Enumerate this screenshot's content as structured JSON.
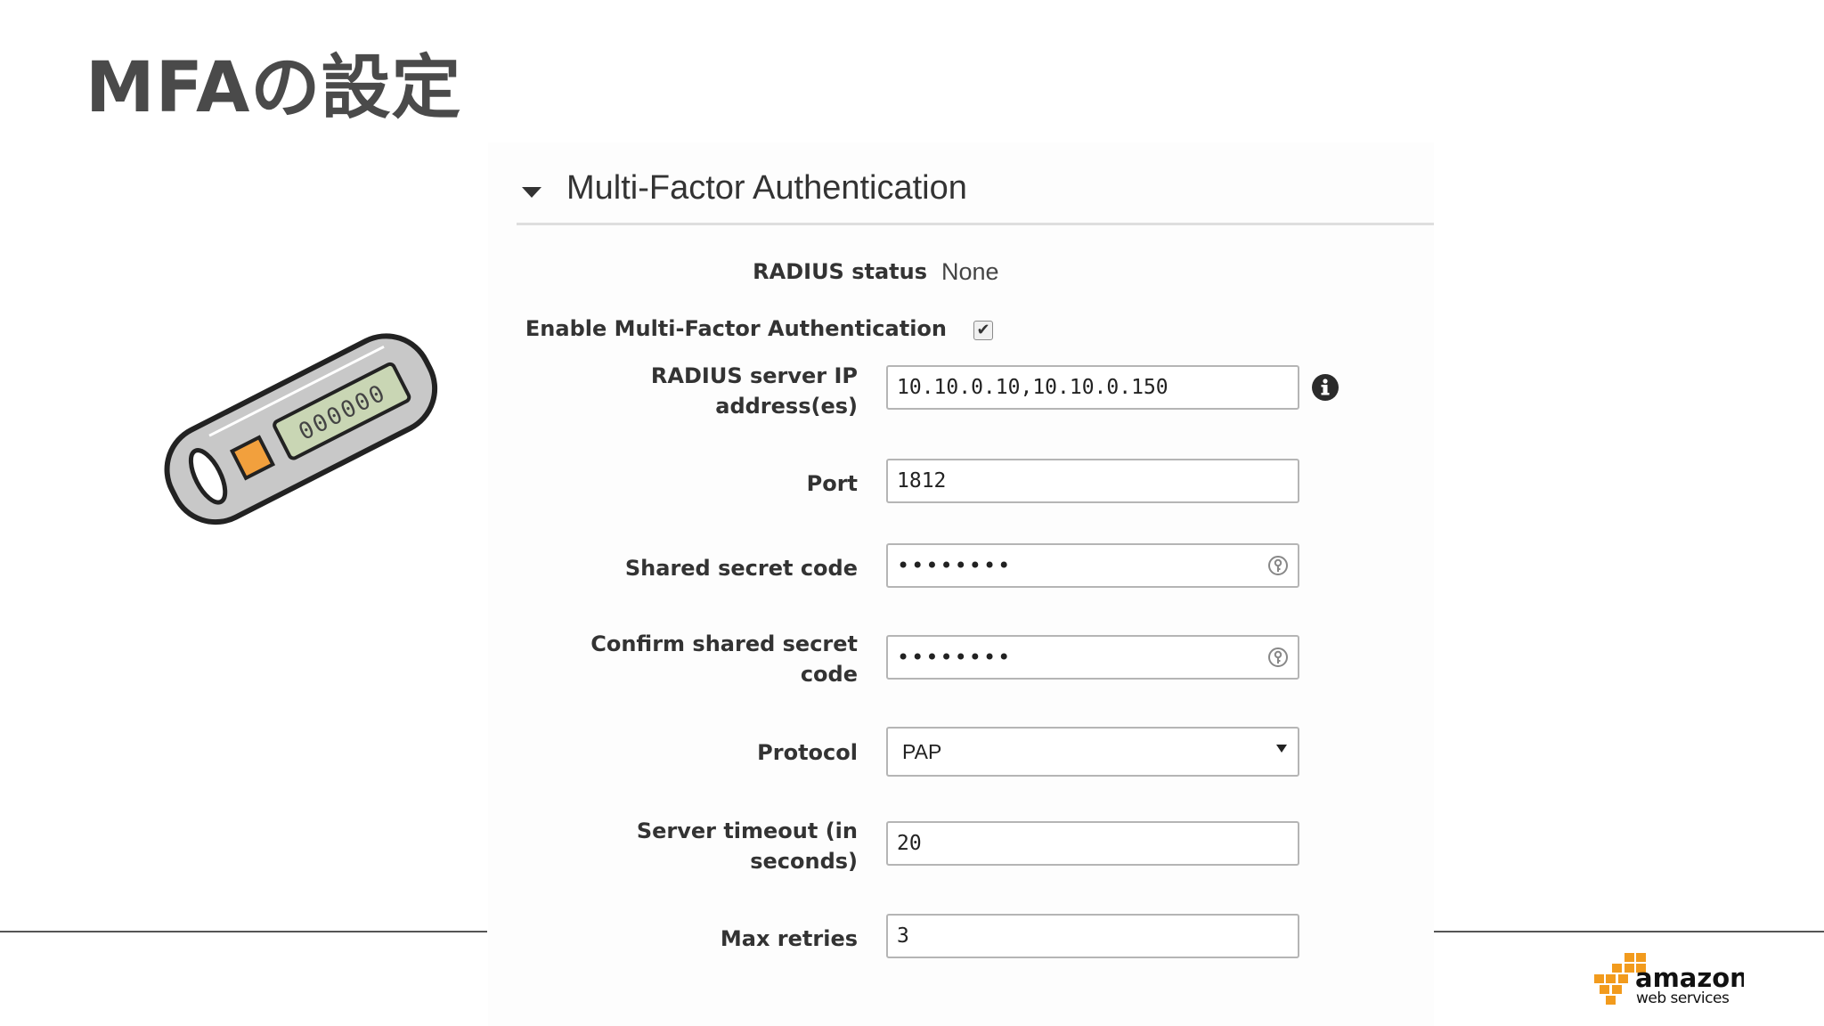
{
  "slide": {
    "title": "MFAの設定"
  },
  "section": {
    "title": "Multi-Factor Authentication",
    "collapse_icon": "caret-down-icon"
  },
  "form": {
    "radius_status": {
      "label": "RADIUS status",
      "value": "None"
    },
    "enable_mfa": {
      "label": "Enable Multi-Factor Authentication",
      "checked": true,
      "check_glyph": "✔"
    },
    "radius_ip": {
      "label_line1": "RADIUS server IP",
      "label_line2": "address(es)",
      "value": "10.10.0.10,10.10.0.150",
      "info_icon": "info-icon"
    },
    "port": {
      "label": "Port",
      "value": "1812"
    },
    "shared_secret": {
      "label": "Shared secret code",
      "value": "••••••••",
      "icon": "key-icon"
    },
    "confirm_secret": {
      "label_line1": "Confirm shared secret",
      "label_line2": "code",
      "value": "••••••••",
      "icon": "key-icon"
    },
    "protocol": {
      "label": "Protocol",
      "value": "PAP"
    },
    "server_timeout": {
      "label_line1": "Server timeout (in",
      "label_line2": "seconds)",
      "value": "20"
    },
    "max_retries": {
      "label": "Max retries",
      "value": "3"
    }
  },
  "token_illustration": {
    "display_text": "000000"
  },
  "logo": {
    "line1": "amazon",
    "line2": "web services"
  },
  "colors": {
    "title": "#4a4a4a",
    "token_body": "#c8c8c8",
    "token_button": "#f2a03d",
    "token_screen": "#c9d6b4",
    "aws_orange": "#f29b1d"
  }
}
